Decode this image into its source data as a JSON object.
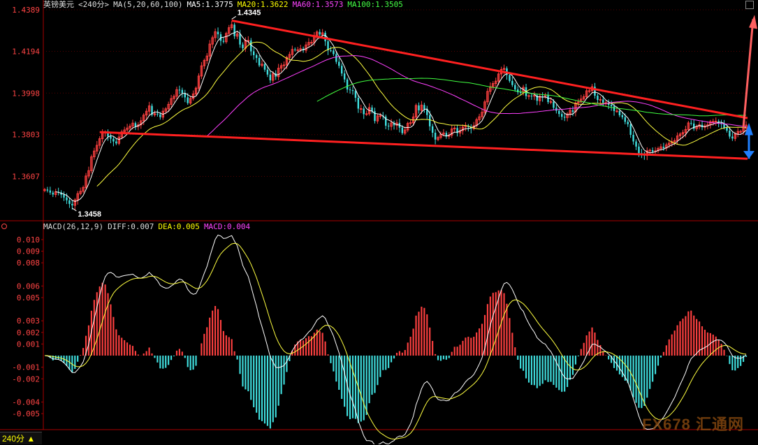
{
  "header": {
    "instrument": "英镑美元",
    "period": "<240分>",
    "ma_label": "MA(5,20,60,100)",
    "ma5": "MA5:1.3775",
    "ma20": "MA20:1.3622",
    "ma60": "MA60:1.3573",
    "ma100": "MA100:1.3505"
  },
  "macd_header": {
    "label": "MACD(26,12,9)",
    "diff": "DIFF:0.007",
    "dea": "DEA:0.005",
    "macd": "MACD:0.004"
  },
  "period_tab": "240分 ▲",
  "watermark": "FX678 汇通网",
  "colors": {
    "up": "#ff4040",
    "down": "#40e0e0",
    "ma5": "#ffffff",
    "ma20": "#ffff40",
    "ma60": "#ff40ff",
    "ma100": "#40ff40",
    "trend": "#ff2020",
    "arrow_up": "#ff6060",
    "arrow_down": "#2080ff"
  },
  "chart_data": [
    {
      "type": "candlestick",
      "title": "英镑美元 <240分>",
      "ylim": [
        1.3412,
        1.4389
      ],
      "y_ticks": [
        1.4389,
        1.4194,
        1.3998,
        1.3803,
        1.3607
      ],
      "annotations": [
        {
          "label": "1.4345",
          "value": 1.4345,
          "bar": 68
        },
        {
          "label": "1.3458",
          "value": 1.3458,
          "bar": 10
        }
      ],
      "close": [
        1.3545,
        1.3541,
        1.3531,
        1.3522,
        1.3535,
        1.3532,
        1.3521,
        1.3508,
        1.3495,
        1.3478,
        1.3471,
        1.3497,
        1.3526,
        1.3537,
        1.3555,
        1.3609,
        1.3634,
        1.3699,
        1.3726,
        1.3753,
        1.3784,
        1.3812,
        1.3815,
        1.3794,
        1.3784,
        1.3771,
        1.3762,
        1.3792,
        1.3816,
        1.3825,
        1.3834,
        1.3843,
        1.3857,
        1.3841,
        1.3849,
        1.3868,
        1.3895,
        1.3913,
        1.3938,
        1.3896,
        1.3901,
        1.3898,
        1.3885,
        1.3913,
        1.3924,
        1.3945,
        1.3972,
        1.3983,
        1.4014,
        1.4013,
        1.3998,
        1.3978,
        1.3951,
        1.3973,
        1.3994,
        1.4021,
        1.4078,
        1.4126,
        1.4151,
        1.4172,
        1.4228,
        1.4258,
        1.4286,
        1.4274,
        1.4243,
        1.4239,
        1.4278,
        1.4305,
        1.4319,
        1.4265,
        1.4276,
        1.4226,
        1.4209,
        1.4245,
        1.4245,
        1.4194,
        1.4176,
        1.4163,
        1.4128,
        1.4134,
        1.4108,
        1.4085,
        1.4058,
        1.409,
        1.4075,
        1.4115,
        1.4127,
        1.413,
        1.4165,
        1.4179,
        1.4203,
        1.4201,
        1.4201,
        1.4206,
        1.4199,
        1.4224,
        1.4236,
        1.4236,
        1.4268,
        1.4285,
        1.4273,
        1.4281,
        1.4241,
        1.4199,
        1.4198,
        1.4181,
        1.4145,
        1.4126,
        1.409,
        1.4062,
        1.4015,
        1.4012,
        1.4008,
        1.3976,
        1.3925,
        1.3925,
        1.3899,
        1.3901,
        1.393,
        1.3913,
        1.3867,
        1.3891,
        1.3892,
        1.3888,
        1.3845,
        1.3842,
        1.3858,
        1.3847,
        1.3858,
        1.3836,
        1.381,
        1.3825,
        1.3856,
        1.3859,
        1.3886,
        1.394,
        1.3917,
        1.3942,
        1.3923,
        1.3895,
        1.3842,
        1.3812,
        1.378,
        1.379,
        1.3805,
        1.3811,
        1.3795,
        1.3801,
        1.383,
        1.3834,
        1.3811,
        1.3822,
        1.3839,
        1.3845,
        1.3839,
        1.3831,
        1.3845,
        1.3873,
        1.3887,
        1.3908,
        1.3957,
        1.4006,
        1.4028,
        1.4043,
        1.4054,
        1.4088,
        1.4109,
        1.4114,
        1.4083,
        1.4055,
        1.4036,
        1.4015,
        1.4002,
        1.4001,
        1.4025,
        1.3984,
        1.3986,
        1.3984,
        1.3987,
        1.3962,
        1.3983,
        1.398,
        1.3989,
        1.3956,
        1.3958,
        1.3929,
        1.3915,
        1.39,
        1.3887,
        1.3883,
        1.39,
        1.3917,
        1.391,
        1.3951,
        1.3957,
        1.397,
        1.3981,
        1.4009,
        1.4009,
        1.4028,
        1.3986,
        1.3966,
        1.3968,
        1.3953,
        1.3953,
        1.3943,
        1.3936,
        1.3914,
        1.3914,
        1.3894,
        1.3885,
        1.3863,
        1.3852,
        1.3802,
        1.3771,
        1.3747,
        1.3716,
        1.3712,
        1.3705,
        1.3727,
        1.373,
        1.3723,
        1.3727,
        1.3738,
        1.3746,
        1.374,
        1.3755,
        1.3763,
        1.377,
        1.3775,
        1.3797,
        1.3806,
        1.3813,
        1.3827,
        1.3858,
        1.3855,
        1.3831,
        1.384,
        1.3849,
        1.3838,
        1.3844,
        1.3849,
        1.3864,
        1.3865,
        1.3866,
        1.3859,
        1.3853,
        1.3835,
        1.3822,
        1.3794,
        1.3785,
        1.3805,
        1.3818,
        1.3818,
        1.3833,
        1.3848
      ]
    },
    {
      "type": "bar",
      "title": "MACD(26,12,9)",
      "ylim": [
        -0.0062,
        0.0106
      ],
      "y_ticks": [
        0.01,
        0.009,
        0.008,
        0.006,
        0.005,
        0.003,
        0.002,
        0.001,
        -0.001,
        -0.002,
        -0.004,
        -0.005
      ],
      "y_tick_labels": [
        "0.010",
        "0.009",
        "0.008",
        "0.006",
        "0.005",
        "0.003",
        "0.002",
        "0.001",
        "-0.001",
        "-0.002",
        "-0.004",
        "-0.005"
      ]
    }
  ]
}
